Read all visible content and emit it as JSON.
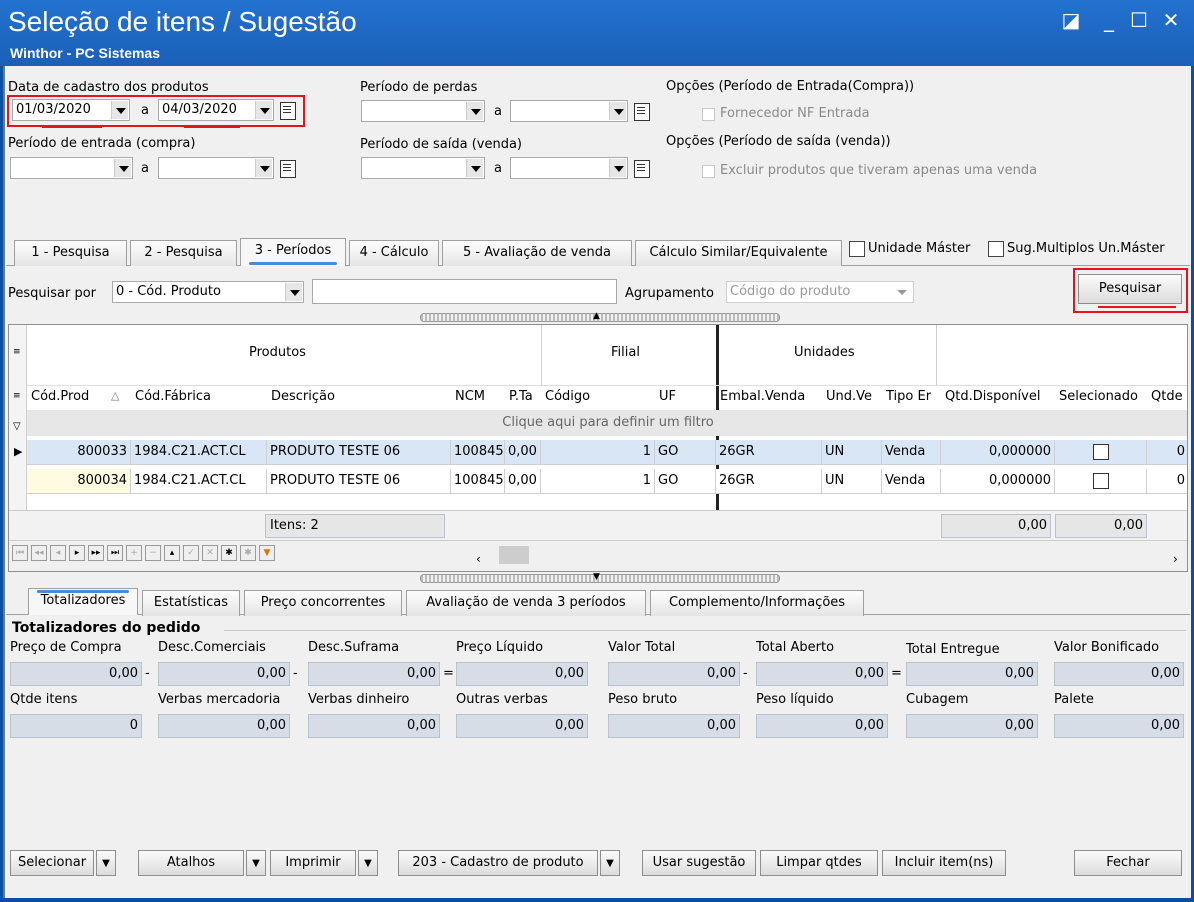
{
  "window": {
    "title": "Seleção de itens / Sugestão",
    "subtitle": "Winthor - PC Sistemas",
    "controls": {
      "restore": "◪",
      "minimize": "_",
      "maximize": "☐",
      "close": "✕"
    }
  },
  "filters": {
    "cadastro_label": "Data de cadastro dos produtos",
    "cadastro_from": "01/03/2020",
    "cadastro_to": "04/03/2020",
    "a": "a",
    "entrada_label": "Período de entrada (compra)",
    "perdas_label": "Período de perdas",
    "saida_label": "Período de saída (venda)",
    "opcoes_entrada_label": "Opções (Período de Entrada(Compra))",
    "fornecedor_nf_label": "Fornecedor NF Entrada",
    "opcoes_saida_label": "Opções (Período de saída (venda))",
    "excluir_label": "Excluir produtos que tiveram apenas uma venda"
  },
  "tabs": [
    {
      "label": "1 - Pesquisa"
    },
    {
      "label": "2 - Pesquisa"
    },
    {
      "label": "3 - Períodos"
    },
    {
      "label": "4 - Cálculo"
    },
    {
      "label": "5 - Avaliação de venda"
    },
    {
      "label": "Cálculo Similar/Equivalente"
    }
  ],
  "options": {
    "unidade_master": "Unidade Máster",
    "sug_multiplos": "Sug.Multiplos Un.Máster"
  },
  "search": {
    "by_label": "Pesquisar por",
    "by_value": "0 - Cód. Produto",
    "text_value": "",
    "agrupamento_label": "Agrupamento",
    "agrupamento_value": "Código do produto",
    "button": "Pesquisar"
  },
  "grid": {
    "bands": {
      "produtos": "Produtos",
      "filial": "Filial",
      "unidades": "Unidades"
    },
    "columns": [
      "Cód.Prod",
      "Cód.Fábrica",
      "Descrição",
      "NCM",
      "P.Ta",
      "Código",
      "UF",
      "Embal.Venda",
      "Und.Ve",
      "Tipo Er",
      "Qtd.Disponível",
      "Selecionado",
      "Qtde"
    ],
    "filter_hint": "Clique aqui para definir um filtro",
    "rows": [
      {
        "cod": "800033",
        "fabrica": "1984.C21.ACT.CL",
        "descricao": "PRODUTO TESTE 06",
        "ncm": "100845",
        "pta": "0,00",
        "codigo": "1",
        "uf": "GO",
        "embal": "26GR",
        "und": "UN",
        "tipo": "Venda",
        "qtd": "0,000000",
        "selecionado": false,
        "qtde": "0"
      },
      {
        "cod": "800034",
        "fabrica": "1984.C21.ACT.CL",
        "descricao": "PRODUTO TESTE 06",
        "ncm": "100845",
        "pta": "0,00",
        "codigo": "1",
        "uf": "GO",
        "embal": "26GR",
        "und": "UN",
        "tipo": "Venda",
        "qtd": "0,000000",
        "selecionado": false,
        "qtde": "0"
      }
    ],
    "footer_items": "Itens: 2",
    "footer_qtd": "0,00",
    "footer_sel": "0,00"
  },
  "bottom_tabs": [
    {
      "label": "Totalizadores"
    },
    {
      "label": "Estatísticas"
    },
    {
      "label": "Preço concorrentes"
    },
    {
      "label": "Avaliação de venda 3 períodos"
    },
    {
      "label": "Complemento/Informações"
    }
  ],
  "totalizadores": {
    "group_title": "Totalizadores do pedido",
    "row1": [
      {
        "label": "Preço de Compra",
        "value": "0,00"
      },
      {
        "label": "Desc.Comerciais",
        "value": "0,00"
      },
      {
        "label": "Desc.Suframa",
        "value": "0,00"
      },
      {
        "label": "Preço Líquido",
        "value": "0,00"
      },
      {
        "label": "Valor Total",
        "value": "0,00"
      },
      {
        "label": "Total Aberto",
        "value": "0,00"
      },
      {
        "label": "Total Entregue",
        "value": "0,00"
      },
      {
        "label": "Valor Bonificado",
        "value": "0,00"
      }
    ],
    "ops": [
      "-",
      "-",
      "=",
      "",
      "-",
      "="
    ],
    "row2": [
      {
        "label": "Qtde itens",
        "value": "0"
      },
      {
        "label": "Verbas mercadoria",
        "value": "0,00"
      },
      {
        "label": "Verbas dinheiro",
        "value": "0,00"
      },
      {
        "label": "Outras verbas",
        "value": "0,00"
      },
      {
        "label": "Peso bruto",
        "value": "0,00"
      },
      {
        "label": "Peso líquido",
        "value": "0,00"
      },
      {
        "label": "Cubagem",
        "value": "0,00"
      },
      {
        "label": "Palete",
        "value": "0,00"
      }
    ]
  },
  "footer_buttons": {
    "selecionar": "Selecionar",
    "atalhos": "Atalhos",
    "imprimir": "Imprimir",
    "cadastro": "203 - Cadastro de produto",
    "usar_sugestao": "Usar sugestão",
    "limpar_qtdes": "Limpar qtdes",
    "incluir": "Incluir item(ns)",
    "fechar": "Fechar"
  },
  "colors": {
    "titlebar": "#1b5fb8",
    "highlight": "#e3141b",
    "field_bg": "#d6dde6"
  }
}
